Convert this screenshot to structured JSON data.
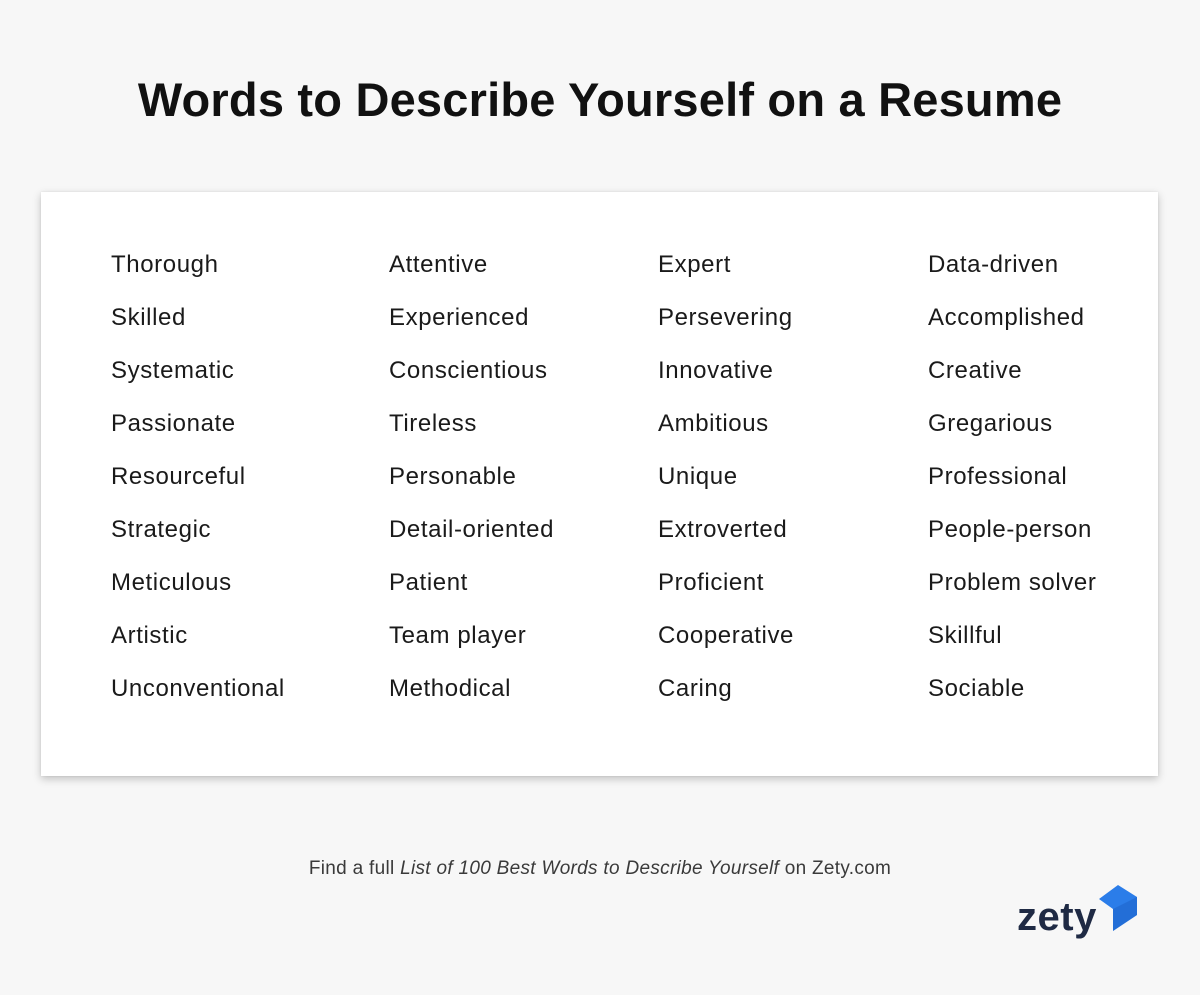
{
  "title": "Words to Describe Yourself on a Resume",
  "columns": [
    [
      "Thorough",
      "Skilled",
      "Systematic",
      "Passionate",
      "Resourceful",
      "Strategic",
      "Meticulous",
      "Artistic",
      "Unconventional"
    ],
    [
      "Attentive",
      "Experienced",
      "Conscientious",
      "Tireless",
      "Personable",
      "Detail-oriented",
      "Patient",
      "Team player",
      "Methodical"
    ],
    [
      "Expert",
      "Persevering",
      "Innovative",
      "Ambitious",
      "Unique",
      "Extroverted",
      "Proficient",
      "Cooperative",
      "Caring"
    ],
    [
      "Data-driven",
      "Accomplished",
      "Creative",
      "Gregarious",
      "Professional",
      "People-person",
      "Problem solver",
      "Skillful",
      "Sociable"
    ]
  ],
  "footer": {
    "prefix": "Find a full ",
    "link_text": "List of 100 Best Words to Describe Yourself",
    "suffix": " on Zety.com"
  },
  "logo": {
    "text": "zety",
    "icon": "zety-logo-icon",
    "brand_color": "#2b7de9",
    "text_color": "#1f2a44"
  }
}
